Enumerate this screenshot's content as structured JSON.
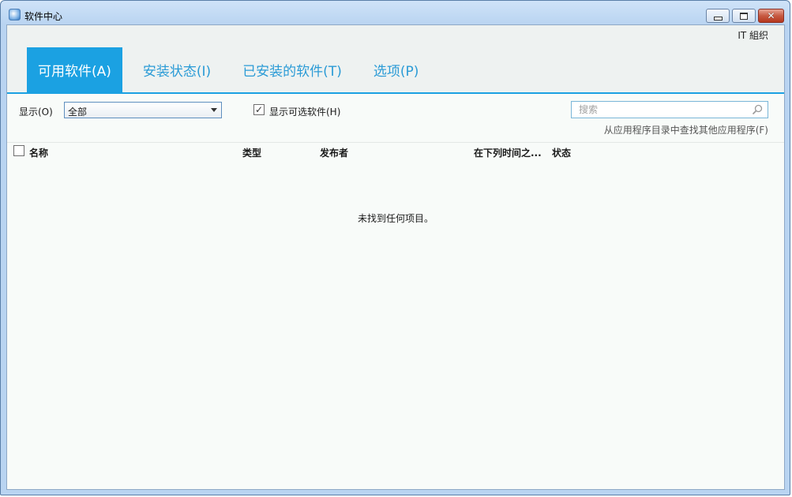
{
  "window": {
    "title": "软件中心",
    "controls": {
      "minimize": "",
      "maximize": "",
      "close": "✕"
    }
  },
  "header": {
    "org_name": "IT 組织",
    "tabs": [
      {
        "label": "可用软件(A)",
        "active": true
      },
      {
        "label": "安装状态(I)",
        "active": false
      },
      {
        "label": "已安装的软件(T)",
        "active": false
      },
      {
        "label": "选项(P)",
        "active": false
      }
    ]
  },
  "toolbar": {
    "filter_label": "显示(O)",
    "filter_value": "全部",
    "optional_checkbox_label": "显示可选软件(H)",
    "optional_checked": true,
    "check_mark": "✓",
    "search_placeholder": "搜索",
    "catalog_link": "从应用程序目录中查找其他应用程序(F)"
  },
  "table": {
    "columns": [
      "名称",
      "类型",
      "发布者",
      "在下列时间之...",
      "状态"
    ],
    "empty_message": "未找到任何项目。"
  },
  "colors": {
    "accent": "#1ba1e2",
    "tab_text": "#2a9bd6",
    "background": "#f8fbf9"
  }
}
